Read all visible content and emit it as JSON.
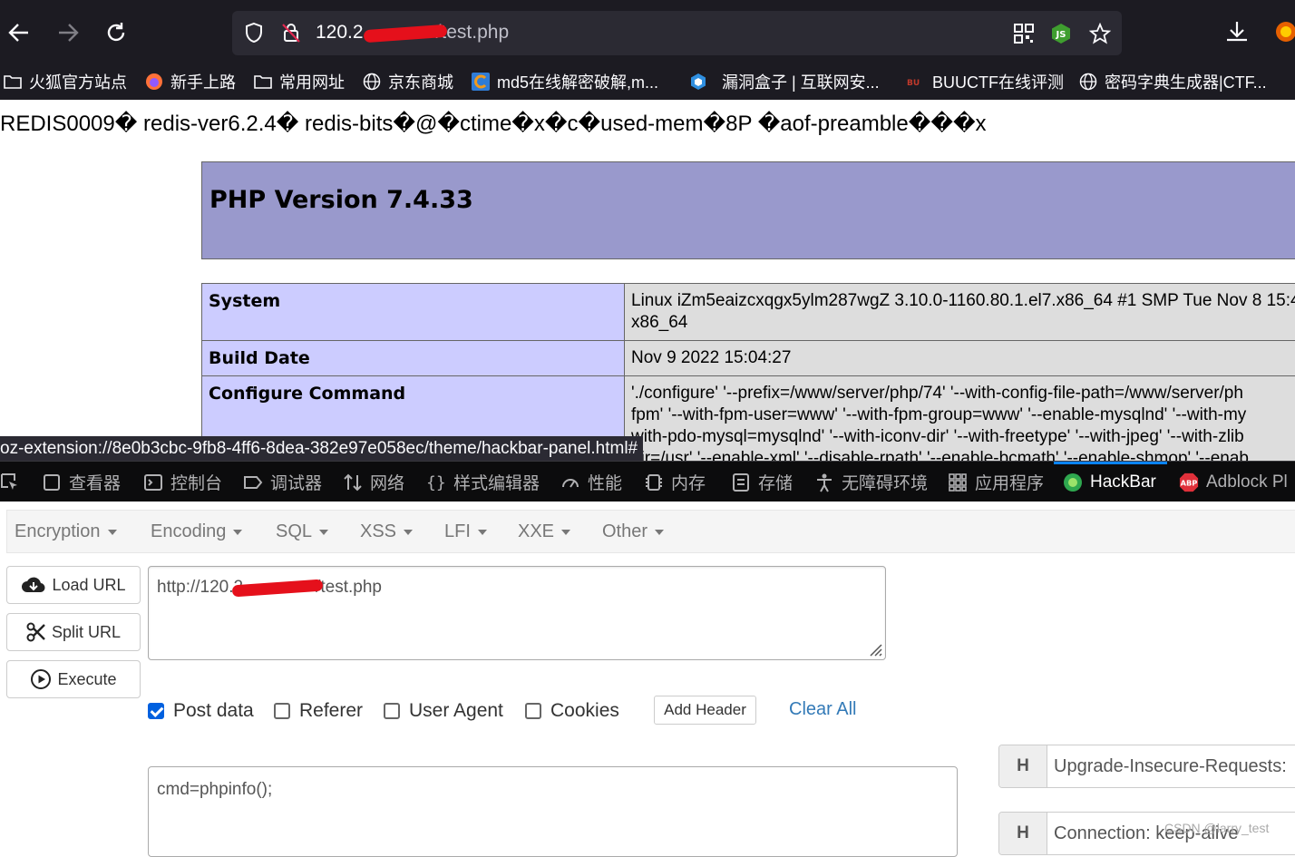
{
  "browser": {
    "url": "120.2●●●●●●●4/test.php",
    "url_visible_prefix": "120.2",
    "url_visible_suffix": "/test.php",
    "extension_url": "oz-extension://8e0b3cbc-9fb8-4ff6-8dea-382e97e058ec/theme/hackbar-panel.html#"
  },
  "bookmarks": [
    {
      "label": "火狐官方站点",
      "icon": "folder-icon"
    },
    {
      "label": "新手上路",
      "icon": "firefox-icon"
    },
    {
      "label": "常用网址",
      "icon": "folder-icon"
    },
    {
      "label": "京东商城",
      "icon": "globe-icon"
    },
    {
      "label": "md5在线解密破解,m...",
      "icon": "cmd5-icon"
    },
    {
      "label": "漏洞盒子 | 互联网安...",
      "icon": "vulbox-icon"
    },
    {
      "label": "BUUCTF在线评测",
      "icon": "buuctf-icon"
    },
    {
      "label": "密码字典生成器|CTF...",
      "icon": "globe-icon"
    }
  ],
  "page": {
    "redis_line": "REDIS0009� redis-ver6.2.4� redis-bits�@�ctime�x�c�used-mem�8P �aof-preamble���x",
    "php_title": "PHP Version 7.4.33",
    "rows": [
      {
        "key": "System",
        "lines": [
          "Linux iZm5eaizcxqgx5ylm287wgZ 3.10.0-1160.80.1.el7.x86_64 #1 SMP Tue Nov 8 15:4",
          "x86_64"
        ]
      },
      {
        "key": "Build Date",
        "lines": [
          "Nov 9 2022 15:04:27"
        ]
      },
      {
        "key": "Configure Command",
        "lines": [
          "'./configure' '--prefix=/www/server/php/74' '--with-config-file-path=/www/server/ph",
          "fpm' '--with-fpm-user=www' '--with-fpm-group=www' '--enable-mysqlnd' '--with-my",
          "with-pdo-mysql=mysqlnd' '--with-iconv-dir' '--with-freetype' '--with-jpeg' '--with-zlib",
          "dir=/usr' '--enable-xml' '--disable-rpath' '--enable-bcmath' '--enable-shmop' '--enab"
        ]
      }
    ]
  },
  "devtools": {
    "tabs": [
      {
        "label": "查看器",
        "icon": "inspector-icon"
      },
      {
        "label": "控制台",
        "icon": "console-icon"
      },
      {
        "label": "调试器",
        "icon": "debugger-icon"
      },
      {
        "label": "网络",
        "icon": "network-icon"
      },
      {
        "label": "样式编辑器",
        "icon": "style-editor-icon"
      },
      {
        "label": "性能",
        "icon": "performance-icon"
      },
      {
        "label": "内存",
        "icon": "memory-icon"
      },
      {
        "label": "存储",
        "icon": "storage-icon"
      },
      {
        "label": "无障碍环境",
        "icon": "accessibility-icon"
      },
      {
        "label": "应用程序",
        "icon": "application-icon"
      },
      {
        "label": "HackBar",
        "icon": "hackbar-icon",
        "active": true
      },
      {
        "label": "Adblock Pl",
        "icon": "abp-icon"
      }
    ]
  },
  "hackbar": {
    "menu": [
      "Encryption",
      "Encoding",
      "SQL",
      "XSS",
      "LFI",
      "XXE",
      "Other"
    ],
    "load_url": "Load URL",
    "split_url": "Split URL",
    "execute": "Execute",
    "url_value_prefix": "http://120.2",
    "url_value_suffix": "/test.php",
    "options": [
      {
        "label": "Post data",
        "checked": true
      },
      {
        "label": "Referer",
        "checked": false
      },
      {
        "label": "User Agent",
        "checked": false
      },
      {
        "label": "Cookies",
        "checked": false
      }
    ],
    "add_header": "Add Header",
    "clear_all": "Clear All",
    "post_data": "cmd=phpinfo();",
    "headers": [
      {
        "h": "H",
        "value": "Upgrade-Insecure-Requests:"
      },
      {
        "h": "H",
        "value": "Connection: keep-alive"
      }
    ]
  },
  "watermark": "CSDN @larry_test",
  "colors": {
    "browser_chrome": "#1c1b22",
    "php_header": "#9999cc",
    "php_key": "#ccccff",
    "php_value": "#dddddd",
    "redaction": "#e5101b",
    "accent": "#0a84ff"
  }
}
